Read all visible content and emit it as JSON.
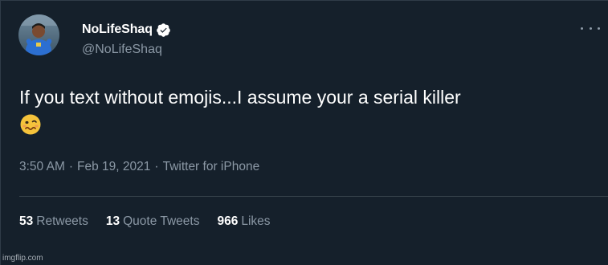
{
  "author": {
    "display_name": "NoLifeShaq",
    "handle": "@NoLifeShaq",
    "verified": true,
    "avatar_icon": "avatar-photo"
  },
  "tweet": {
    "text": "If you text without emojis...I assume your a serial killer",
    "emoji": "woozy-face-emoji"
  },
  "meta": {
    "time": "3:50 AM",
    "separator": "·",
    "date": "Feb 19, 2021",
    "separator2": "·",
    "source": "Twitter for iPhone"
  },
  "stats": {
    "retweets_count": "53",
    "retweets_label": "Retweets",
    "quotes_count": "13",
    "quotes_label": "Quote Tweets",
    "likes_count": "966",
    "likes_label": "Likes"
  },
  "watermark": "imgflip.com",
  "colors": {
    "background": "#15202b",
    "text_primary": "#ffffff",
    "text_secondary": "#8b98a5",
    "divider": "#38444d"
  }
}
